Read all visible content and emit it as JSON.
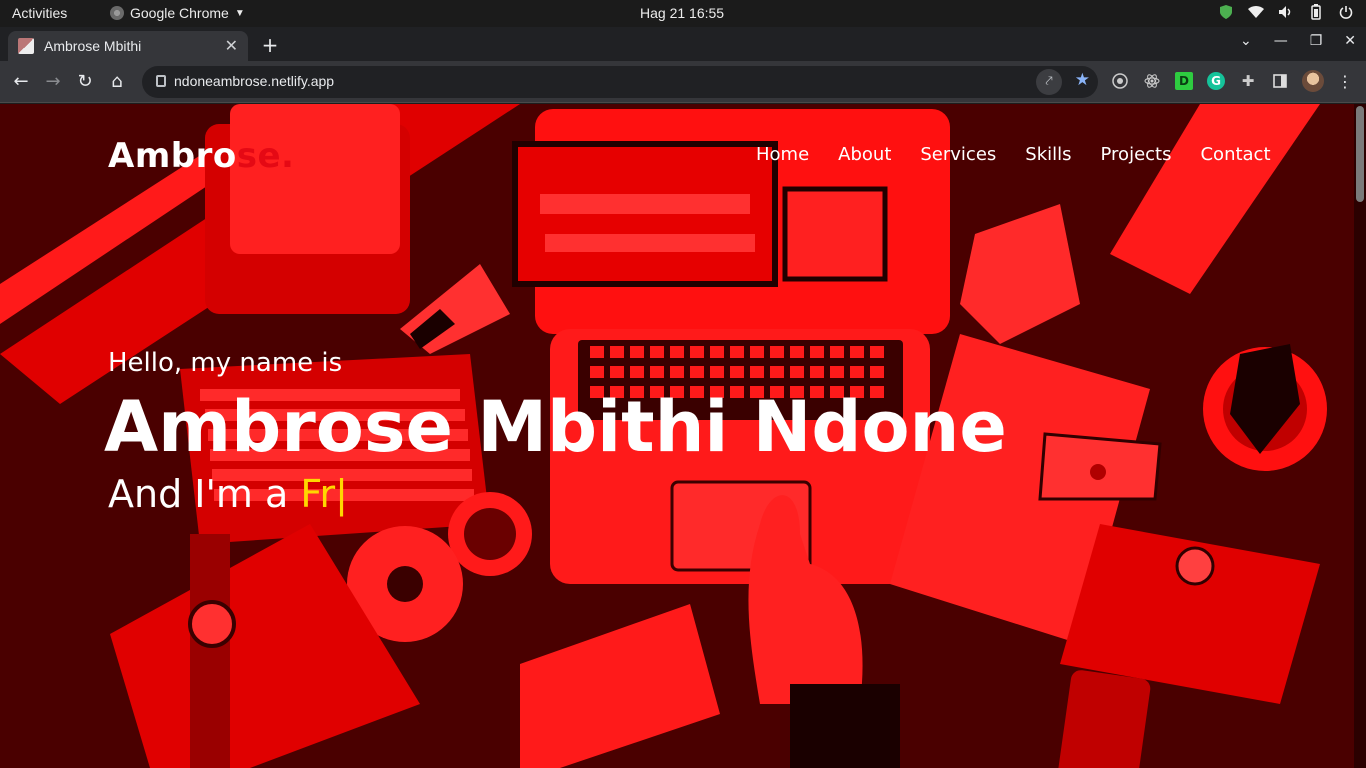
{
  "system_bar": {
    "activities": "Activities",
    "app_name": "Google Chrome",
    "clock": "Hag 21  16:55"
  },
  "browser": {
    "tab_title": "Ambrose Mbithi",
    "url": "ndoneambrose.netlify.app",
    "new_tab_label": "+"
  },
  "site": {
    "logo": {
      "main": "Ambro",
      "accent": "se."
    },
    "nav": [
      {
        "label": "Home"
      },
      {
        "label": "About"
      },
      {
        "label": "Services"
      },
      {
        "label": "Skills"
      },
      {
        "label": "Projects"
      },
      {
        "label": "Contact"
      }
    ],
    "hero": {
      "greeting": "Hello, my name is",
      "name": "Ambrose Mbithi Ndone",
      "role_prefix": "And I'm a ",
      "role_typed": "Fr",
      "cursor": "|"
    },
    "colors": {
      "accent": "#e50914",
      "highlight": "#ffd700",
      "bg": "#b30000"
    }
  }
}
